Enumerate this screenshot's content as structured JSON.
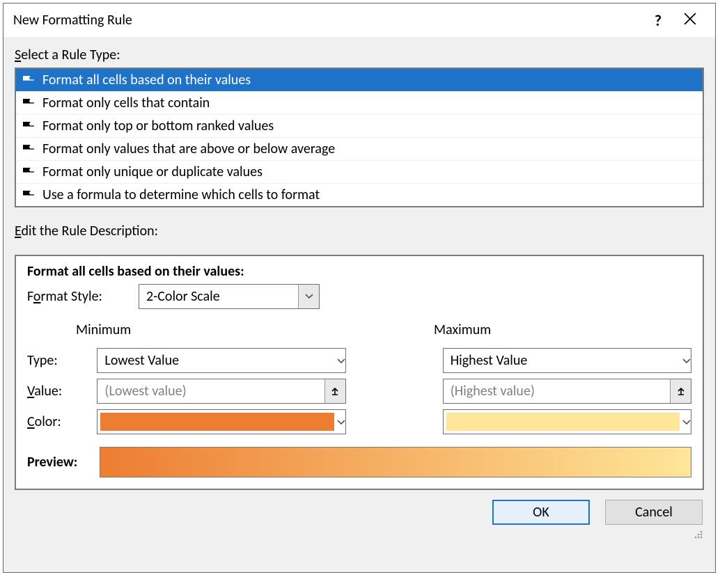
{
  "titlebar": {
    "title": "New Formatting Rule",
    "help_glyph": "?"
  },
  "sections": {
    "select_label_pre": "S",
    "select_label_rest": "elect a Rule Type:",
    "edit_label_pre": "E",
    "edit_label_rest": "dit the Rule Description:"
  },
  "ruletypes": [
    {
      "label": "Format all cells based on their values",
      "selected": true
    },
    {
      "label": "Format only cells that contain",
      "selected": false
    },
    {
      "label": "Format only top or bottom ranked values",
      "selected": false
    },
    {
      "label": "Format only values that are above or below average",
      "selected": false
    },
    {
      "label": "Format only unique or duplicate values",
      "selected": false
    },
    {
      "label": "Use a formula to determine which cells to format",
      "selected": false
    }
  ],
  "desc": {
    "heading": "Format all cells based on their values:",
    "format_style_label_pre": "F",
    "format_style_label_mid": "o",
    "format_style_label_rest": "rmat Style:",
    "format_style_value": "2-Color Scale",
    "type_label": "Type:",
    "value_label_pre": "V",
    "value_label_rest": "alue:",
    "color_label_pre": "C",
    "color_label_rest": "olor:",
    "min_head": "Minimum",
    "max_head": "Maximum",
    "min_type": "Lowest Value",
    "max_type": "Highest Value",
    "min_value_placeholder": "(Lowest value)",
    "max_value_placeholder": "(Highest value)",
    "min_color": "#ed7d31",
    "max_color": "#ffe699",
    "preview_label": "Preview:"
  },
  "buttons": {
    "ok": "OK",
    "cancel": "Cancel"
  }
}
